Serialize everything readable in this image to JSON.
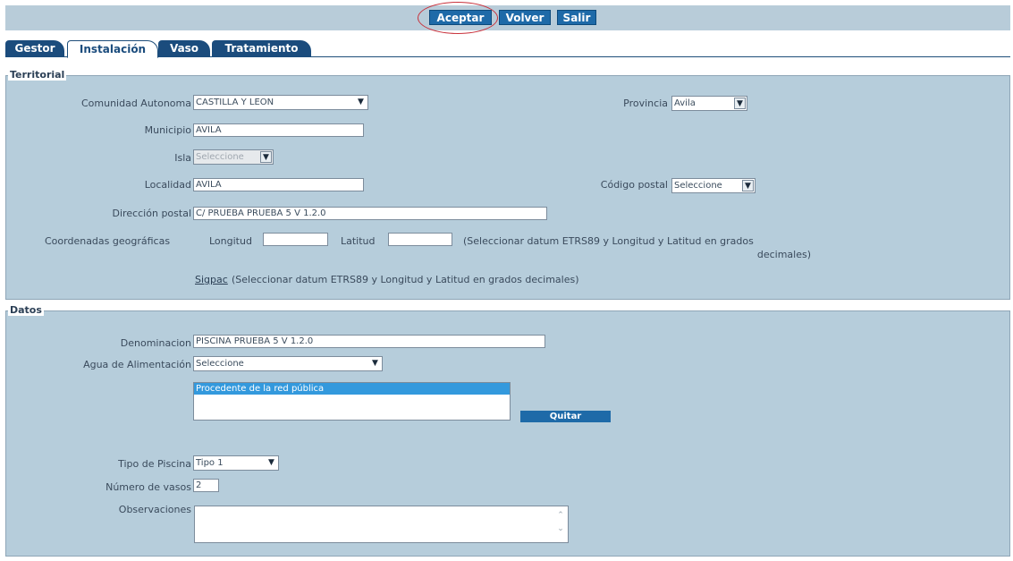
{
  "toolbar": {
    "aceptar": "Aceptar",
    "volver": "Volver",
    "salir": "Salir"
  },
  "tabs": [
    "Gestor",
    "Instalación",
    "Vaso",
    "Tratamiento"
  ],
  "territorial": {
    "legend": "Territorial",
    "comunidad_label": "Comunidad Autonoma",
    "comunidad_value": "CASTILLA Y LEON",
    "provincia_label": "Provincia",
    "provincia_value": "Avila",
    "municipio_label": "Municipio",
    "municipio_value": "AVILA",
    "isla_label": "Isla",
    "isla_value": "Seleccione",
    "localidad_label": "Localidad",
    "localidad_value": "AVILA",
    "codigo_postal_label": "Código postal",
    "codigo_postal_value": "Seleccione",
    "direccion_label": "Dirección postal",
    "direccion_value": "C/ PRUEBA PRUEBA 5 V 1.2.0",
    "coordenadas_label": "Coordenadas geográficas",
    "longitud_label": "Longitud",
    "longitud_value": "",
    "latitud_label": "Latitud",
    "latitud_value": "",
    "coordenadas_hint_1": "(Seleccionar datum ETRS89 y Longitud y Latitud en grados",
    "coordenadas_hint_2": "decimales)",
    "sigpac_link": "Sigpac",
    "sigpac_hint": " (Seleccionar datum ETRS89 y Longitud y Latitud en grados decimales)"
  },
  "datos": {
    "legend": "Datos",
    "denominacion_label": "Denominacion",
    "denominacion_value": "PISCINA PRUEBA 5 V 1.2.0",
    "agua_label": "Agua de Alimentación",
    "agua_value": "Seleccione",
    "agua_list": [
      "Procedente de la red pública"
    ],
    "quitar": "Quitar",
    "tipo_label": "Tipo de Piscina",
    "tipo_value": "Tipo 1",
    "vasos_label": "Número de vasos",
    "vasos_value": "2",
    "observaciones_label": "Observaciones",
    "observaciones_value": ""
  },
  "icons": {
    "dropdown": "chevron-down-icon",
    "scroll": "scroll-arrows-icon"
  },
  "colors": {
    "panel": "#b6cddb",
    "topbar": "#b8ccd9",
    "button": "#1e6aa8",
    "tab": "#1b4c7d",
    "highlight": "#c8303a",
    "selection": "#3399dd"
  }
}
